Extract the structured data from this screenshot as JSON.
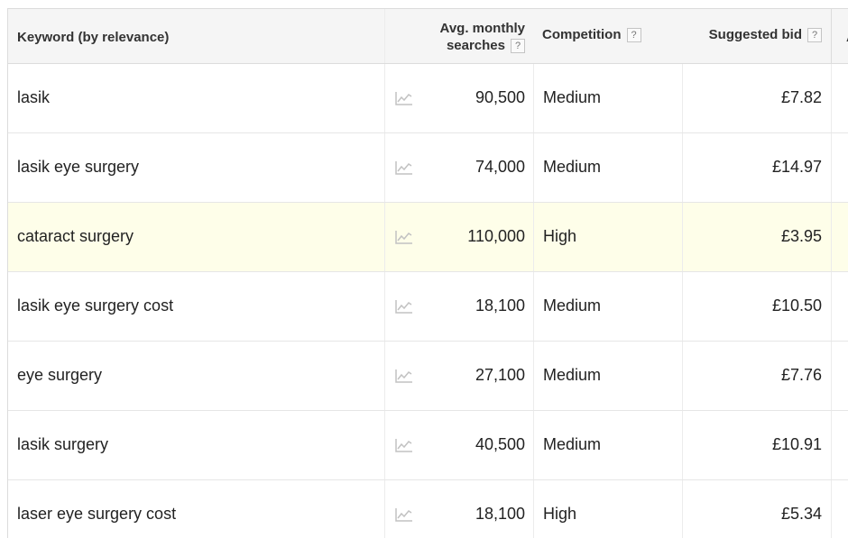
{
  "header": {
    "keyword": "Keyword (by relevance)",
    "avg_line1": "Avg. monthly",
    "avg_line2": "searches",
    "competition": "Competition",
    "suggested_bid": "Suggested bid",
    "help": "?",
    "extra": "A"
  },
  "rows": [
    {
      "keyword": "lasik",
      "avg": "90,500",
      "competition": "Medium",
      "bid": "£7.82"
    },
    {
      "keyword": "lasik eye surgery",
      "avg": "74,000",
      "competition": "Medium",
      "bid": "£14.97"
    },
    {
      "keyword": "cataract surgery",
      "avg": "110,000",
      "competition": "High",
      "bid": "£3.95"
    },
    {
      "keyword": "lasik eye surgery cost",
      "avg": "18,100",
      "competition": "Medium",
      "bid": "£10.50"
    },
    {
      "keyword": "eye surgery",
      "avg": "27,100",
      "competition": "Medium",
      "bid": "£7.76"
    },
    {
      "keyword": "lasik surgery",
      "avg": "40,500",
      "competition": "Medium",
      "bid": "£10.91"
    },
    {
      "keyword": "laser eye surgery cost",
      "avg": "18,100",
      "competition": "High",
      "bid": "£5.34"
    }
  ],
  "highlighted_row": 2,
  "icons": {
    "trend": "trend-chart-icon",
    "help": "help-icon"
  },
  "colors": {
    "header_bg": "#f5f5f5",
    "highlight_bg": "#fefee9",
    "border": "#dcdcdc"
  }
}
